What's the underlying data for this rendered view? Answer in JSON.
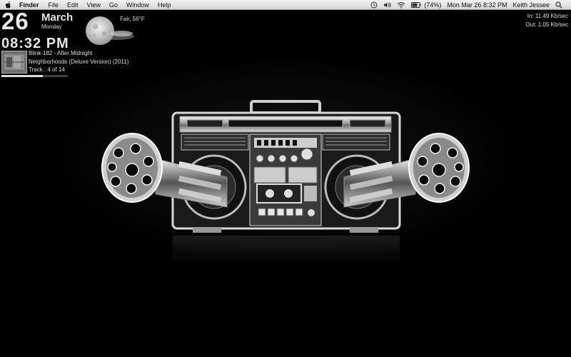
{
  "menubar": {
    "app_name": "Finder",
    "menus": [
      "File",
      "Edit",
      "View",
      "Go",
      "Window",
      "Help"
    ],
    "battery": "(74%)",
    "datetime": "Mon Mar 26  8:32 PM",
    "user": "Keith Jessee",
    "battery_level": 0.74
  },
  "widgets": {
    "date_day": "26",
    "date_month": "March",
    "date_weekday": "Monday",
    "time": "08:32 PM",
    "weather": "Fair, 56°F",
    "now_playing": {
      "title": "Blink-182 - After Midnight",
      "album": "Neighborhoods (Deluxe Version) (2011)",
      "track": "Track : 4 of 14",
      "progress": 0.62
    },
    "network": {
      "in": "In: 11.49 Kb/sec",
      "out": "Out: 1.05 Kb/sec"
    }
  },
  "icons": [
    "apple-icon",
    "time-machine-icon",
    "volume-icon",
    "wifi-icon",
    "battery-icon",
    "spotlight-icon"
  ]
}
